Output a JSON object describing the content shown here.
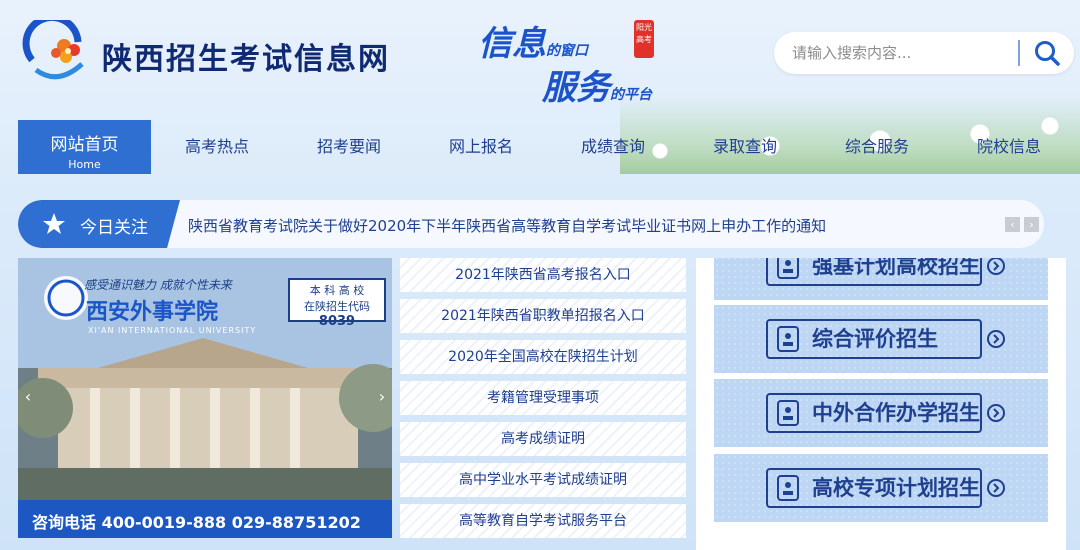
{
  "header": {
    "site_name": "陕西招生考试信息网",
    "slogan_line1": "信息",
    "slogan_small1": "的窗口",
    "slogan_line2": "服务",
    "slogan_small2": "的平台",
    "seal_text": "阳光高考"
  },
  "search": {
    "placeholder": "请输入搜索内容..."
  },
  "nav": {
    "items": [
      {
        "label": "网站首页",
        "sub": "Home"
      },
      {
        "label": "高考热点"
      },
      {
        "label": "招考要闻"
      },
      {
        "label": "网上报名"
      },
      {
        "label": "成绩查询"
      },
      {
        "label": "录取查询"
      },
      {
        "label": "综合服务"
      },
      {
        "label": "院校信息"
      }
    ]
  },
  "notice": {
    "label": "今日关注",
    "text": "陕西省教育考试院关于做好2020年下半年陕西省高等教育自学考试毕业证书网上申办工作的通知",
    "prev": "‹",
    "next": "›"
  },
  "banner": {
    "slogan": "感受通识魅力  成就个性未来",
    "school_name": "西安外事学院",
    "school_name_en": "XI'AN INTERNATIONAL UNIVERSITY",
    "badge_line1": "本 科 高 校",
    "badge_line2": "在陕招生代码",
    "badge_code": "8039",
    "contact": "咨询电话  400-0019-888  029-88751202",
    "prev": "‹",
    "next": "›"
  },
  "links": [
    "2021年陕西省高考报名入口",
    "2021年陕西省职教单招报名入口",
    "2020年全国高校在陕招生计划",
    "考籍管理受理事项",
    "高考成绩证明",
    "高中学业水平考试成绩证明",
    "高等教育自学考试服务平台"
  ],
  "right_buttons": [
    {
      "label": "强基计划高校招生"
    },
    {
      "label": "综合评价招生"
    },
    {
      "label": "中外合作办学招生"
    },
    {
      "label": "高校专项计划招生"
    }
  ],
  "colors": {
    "primary": "#2f6fd2",
    "text_dark": "#1f3f8f",
    "banner_footer": "#1d57c2"
  }
}
